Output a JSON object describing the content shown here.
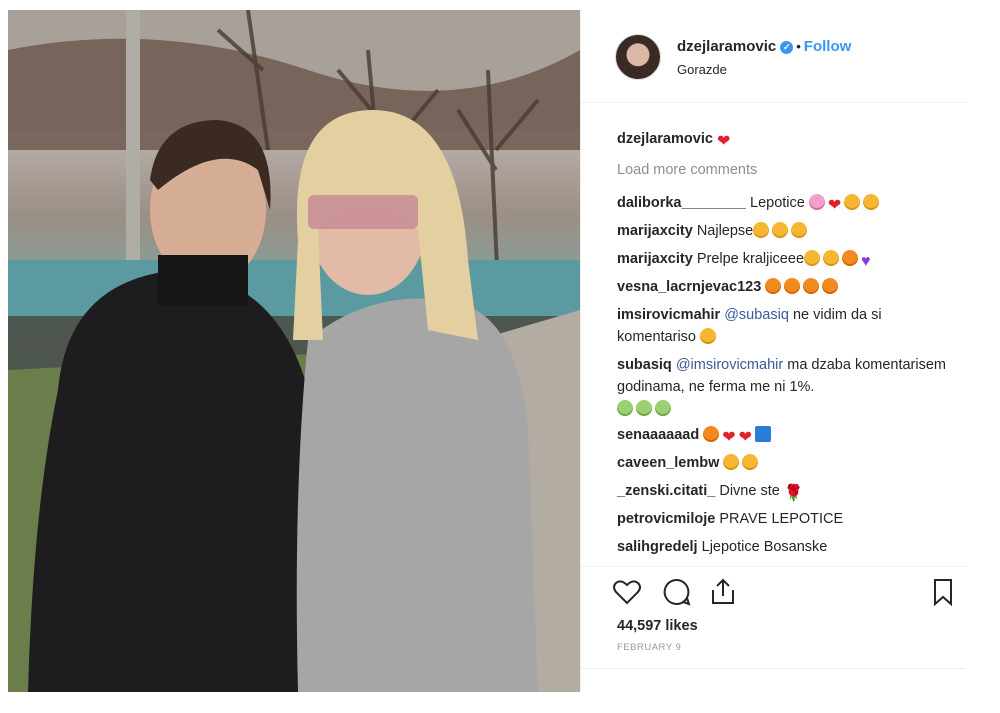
{
  "post": {
    "username": "dzejlaramovic",
    "verified_icon": "verified-badge-icon",
    "separator": "•",
    "follow_label": "Follow",
    "location": "Gorazde"
  },
  "caption": {
    "username": "dzejlaramovic",
    "emoji": "❤"
  },
  "load_more": "Load more comments",
  "comments": [
    {
      "user": "daliborka________",
      "text": "Lepotice",
      "emoji": [
        "pinkflower",
        "heart",
        "smiley",
        "smiley"
      ]
    },
    {
      "user": "marijaxcity",
      "text": "Najlepse",
      "emoji": [
        "smiley",
        "smiley",
        "smiley"
      ]
    },
    {
      "user": "marijaxcity",
      "text": "Prelpe kraljiceee",
      "emoji": [
        "smiley",
        "smiley",
        "orange",
        "purple"
      ]
    },
    {
      "user": "vesna_lacrnjevac123",
      "text": "",
      "emoji": [
        "orange",
        "orange",
        "orange",
        "orange"
      ]
    },
    {
      "user": "imsirovicmahir",
      "mention": "@subasiq",
      "text": "ne vidim da si komentariso",
      "emoji": [
        "smiley"
      ]
    },
    {
      "user": "subasiq",
      "mention": "@imsirovicmahir",
      "text": "ma dzaba komentarisem godinama, ne ferma me ni 1%.",
      "emoji": [
        "green",
        "green",
        "green"
      ]
    },
    {
      "user": "senaaaaaad",
      "text": "",
      "emoji": [
        "orange",
        "heart",
        "heart",
        "blue"
      ]
    },
    {
      "user": "caveen_lembw",
      "text": "",
      "emoji": [
        "smiley",
        "smiley"
      ]
    },
    {
      "user": "_zenski.citati_",
      "text": "Divne ste",
      "emoji": [
        "rose"
      ]
    },
    {
      "user": "petrovicmiloje",
      "text": "PRAVE LEPOTICE",
      "emoji": []
    },
    {
      "user": "salihgredelj",
      "text": "Ljepotice Bosanske",
      "emoji": []
    }
  ],
  "actions": {
    "like_icon": "heart-outline-icon",
    "comment_icon": "comment-bubble-icon",
    "share_icon": "share-icon",
    "save_icon": "bookmark-icon"
  },
  "likes": "44,597 likes",
  "date": "FEBRUARY 9",
  "colors": {
    "link": "#3897f0",
    "text": "#262626",
    "muted": "#8e8e8e",
    "border": "#efefef"
  }
}
